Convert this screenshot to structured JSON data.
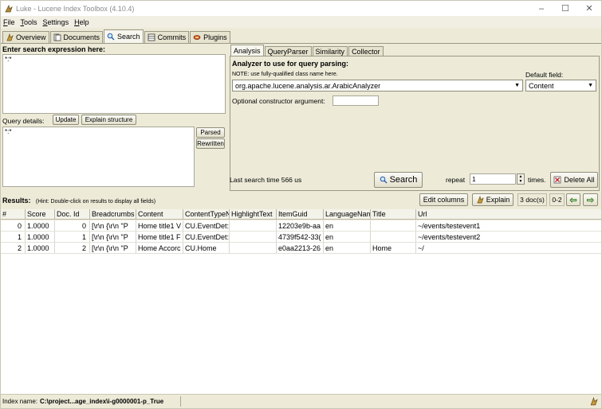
{
  "window": {
    "title": "Luke - Lucene Index Toolbox (4.10.4)",
    "minimize": "–",
    "maximize": "☐",
    "close": "✕"
  },
  "menu": [
    {
      "u": "F",
      "rest": "ile"
    },
    {
      "u": "T",
      "rest": "ools"
    },
    {
      "u": "S",
      "rest": "ettings"
    },
    {
      "u": "H",
      "rest": "elp"
    }
  ],
  "tabs": [
    "Overview",
    "Documents",
    "Search",
    "Commits",
    "Plugins"
  ],
  "search": {
    "expr_label": "Enter search expression here:",
    "expr_value": "*:*",
    "query_details_label": "Query details:",
    "update_btn": "Update",
    "explain_structure_btn": "Explain structure",
    "details_value": "*:*",
    "parsed_btn": "Parsed",
    "rewritten_btn": "Rewritten",
    "right_tabs": [
      "Analysis",
      "QueryParser",
      "Similarity",
      "Collector"
    ],
    "analyzer_label": "Analyzer to use for query parsing:",
    "note": "NOTE: use fully-qualified class name here.",
    "default_field_label": "Default field:",
    "analyzer_value": "org.apache.lucene.analysis.ar.ArabicAnalyzer",
    "default_field_value": "Content",
    "ctor_label": "Optional constructor argument:",
    "ctor_value": "",
    "last_search": "Last search time 566 us",
    "search_btn": "Search",
    "repeat_label": "repeat",
    "repeat_value": "1",
    "times_label": "times.",
    "delete_all_btn": "Delete All"
  },
  "results": {
    "label": "Results:",
    "hint": "(Hint: Double-click on results to display all fields)",
    "edit_columns_btn": "Edit columns",
    "explain_btn": "Explain",
    "doc_count": "3 doc(s)",
    "range": "0-2",
    "columns": [
      "#",
      "Score",
      "Doc. Id",
      "Breadcrumbs",
      "Content",
      "ContentTypeN",
      "HighlightText",
      "ItemGuid",
      "LanguageNam",
      "Title",
      "Url"
    ],
    "rows": [
      [
        "0",
        "1.0000",
        "0",
        "[\\r\\n  {\\r\\n    \"P",
        "Home title1 V",
        "CU.EventDet:",
        "",
        "12203e9b-aa",
        "en",
        "",
        "~/events/testevent1"
      ],
      [
        "1",
        "1.0000",
        "1",
        "[\\r\\n  {\\r\\n    \"P",
        "Home title1 F",
        "CU.EventDet:",
        "",
        "4739f542-33(",
        "en",
        "",
        "~/events/testevent2"
      ],
      [
        "2",
        "1.0000",
        "2",
        "[\\r\\n  {\\r\\n    \"P",
        "Home Accorc",
        "CU.Home",
        "",
        "e0aa2213-26",
        "en",
        "Home",
        "~/"
      ]
    ]
  },
  "status": {
    "label": "Index name:",
    "value": "C:\\project...age_index\\i-g0000001-p_True"
  },
  "colors": {
    "background": "#edebd8",
    "border": "#9a9886",
    "arrow": "#2f7d1e"
  }
}
